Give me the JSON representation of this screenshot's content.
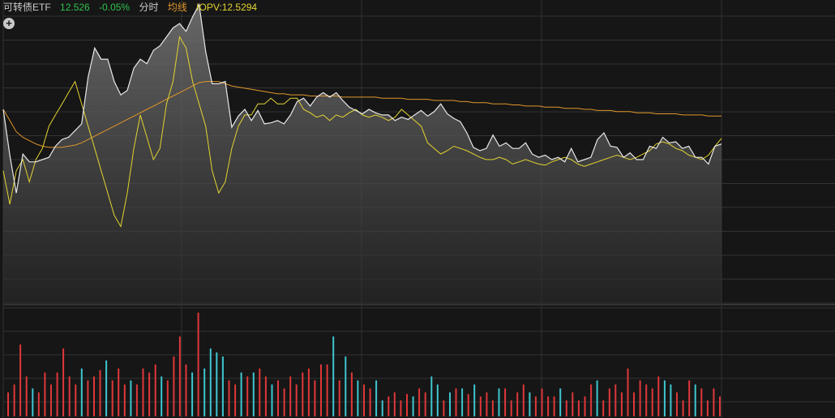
{
  "header": {
    "name": "可转债ETF",
    "price": "12.526",
    "change": "-0.05%",
    "time_label": "分时",
    "ma_label": "均线",
    "iopv_label": "IOPV:12.5294"
  },
  "colors": {
    "background": "#161616",
    "name": "#cccccc",
    "down": "#2fc24f",
    "price_line": "#e8e8e8",
    "ma_line": "#e0962c",
    "iopv_line": "#e3d431",
    "vol_up": "#e0373a",
    "vol_down": "#3ec6d0",
    "grid": "#333333"
  },
  "icons": {
    "zoom": "plus-circle-icon"
  },
  "chart_data": {
    "type": "line",
    "price_range": [
      12.38,
      12.64
    ],
    "price_series": [
      12.555,
      12.514,
      12.48,
      12.515,
      12.508,
      12.508,
      12.51,
      12.512,
      12.522,
      12.528,
      12.53,
      12.536,
      12.542,
      12.584,
      12.61,
      12.6,
      12.6,
      12.58,
      12.568,
      12.572,
      12.592,
      12.6,
      12.596,
      12.608,
      12.612,
      12.62,
      12.628,
      12.632,
      12.625,
      12.638,
      12.649,
      12.607,
      12.578,
      12.578,
      12.58,
      12.539,
      12.549,
      12.555,
      12.545,
      12.554,
      12.542,
      12.543,
      12.545,
      12.542,
      12.55,
      12.562,
      12.565,
      12.558,
      12.566,
      12.57,
      12.566,
      12.57,
      12.563,
      12.557,
      12.554,
      12.551,
      12.555,
      12.552,
      12.55,
      12.55,
      12.545,
      12.548,
      12.546,
      12.55,
      12.554,
      12.549,
      12.553,
      12.56,
      12.551,
      12.547,
      12.544,
      12.534,
      12.521,
      12.518,
      12.52,
      12.532,
      12.522,
      12.525,
      12.52,
      12.52,
      12.525,
      12.515,
      12.512,
      12.514,
      12.51,
      12.512,
      12.508,
      12.52,
      12.508,
      12.51,
      12.512,
      12.528,
      12.534,
      12.522,
      12.521,
      12.512,
      12.516,
      12.51,
      12.51,
      12.522,
      12.52,
      12.53,
      12.525,
      12.526,
      12.52,
      12.522,
      12.512,
      12.512,
      12.506,
      12.522,
      12.524
    ],
    "iopv_series": [
      12.5,
      12.47,
      12.5,
      12.51,
      12.49,
      12.51,
      12.52,
      12.54,
      12.55,
      12.56,
      12.57,
      12.58,
      12.56,
      12.54,
      12.52,
      12.5,
      12.48,
      12.46,
      12.45,
      12.48,
      12.52,
      12.55,
      12.53,
      12.51,
      12.52,
      12.56,
      12.58,
      12.62,
      12.61,
      12.58,
      12.56,
      12.54,
      12.5,
      12.48,
      12.49,
      12.52,
      12.54,
      12.55,
      12.55,
      12.56,
      12.56,
      12.565,
      12.56,
      12.56,
      12.565,
      12.565,
      12.555,
      12.552,
      12.548,
      12.55,
      12.545,
      12.55,
      12.548,
      12.552,
      12.555,
      12.55,
      12.548,
      12.55,
      12.548,
      12.545,
      12.548,
      12.555,
      12.55,
      12.545,
      12.54,
      12.525,
      12.52,
      12.515,
      12.518,
      12.522,
      12.52,
      12.518,
      12.515,
      12.512,
      12.51,
      12.51,
      12.512,
      12.51,
      12.506,
      12.508,
      12.51,
      12.508,
      12.506,
      12.505,
      12.508,
      12.51,
      12.512,
      12.51,
      12.506,
      12.504,
      12.506,
      12.508,
      12.51,
      12.512,
      12.514,
      12.512,
      12.51,
      12.512,
      12.515,
      12.518,
      12.524,
      12.526,
      12.524,
      12.52,
      12.518,
      12.514,
      12.512,
      12.51,
      12.514,
      12.522,
      12.529
    ],
    "ma_series": [
      12.555,
      12.545,
      12.535,
      12.53,
      12.527,
      12.524,
      12.522,
      12.521,
      12.521,
      12.521,
      12.522,
      12.523,
      12.525,
      12.528,
      12.531,
      12.534,
      12.537,
      12.54,
      12.543,
      12.546,
      12.549,
      12.552,
      12.555,
      12.558,
      12.561,
      12.564,
      12.567,
      12.57,
      12.573,
      12.576,
      12.579,
      12.58,
      12.58,
      12.58,
      12.578,
      12.576,
      12.575,
      12.574,
      12.573,
      12.572,
      12.571,
      12.57,
      12.569,
      12.569,
      12.568,
      12.568,
      12.568,
      12.567,
      12.567,
      12.567,
      12.567,
      12.567,
      12.566,
      12.566,
      12.566,
      12.566,
      12.566,
      12.566,
      12.565,
      12.565,
      12.565,
      12.565,
      12.564,
      12.564,
      12.564,
      12.564,
      12.563,
      12.563,
      12.563,
      12.563,
      12.562,
      12.562,
      12.561,
      12.561,
      12.561,
      12.56,
      12.56,
      12.56,
      12.559,
      12.559,
      12.558,
      12.558,
      12.558,
      12.557,
      12.557,
      12.557,
      12.556,
      12.556,
      12.556,
      12.555,
      12.555,
      12.554,
      12.554,
      12.554,
      12.553,
      12.553,
      12.553,
      12.552,
      12.552,
      12.552,
      12.551,
      12.551,
      12.551,
      12.551,
      12.55,
      12.55,
      12.55,
      12.55,
      12.549,
      12.549,
      12.549
    ],
    "volumes": [
      [
        30,
        "r"
      ],
      [
        40,
        "r"
      ],
      [
        90,
        "r"
      ],
      [
        50,
        "r"
      ],
      [
        35,
        "c"
      ],
      [
        30,
        "r"
      ],
      [
        55,
        "r"
      ],
      [
        40,
        "r"
      ],
      [
        55,
        "r"
      ],
      [
        85,
        "r"
      ],
      [
        50,
        "r"
      ],
      [
        40,
        "r"
      ],
      [
        60,
        "c"
      ],
      [
        45,
        "r"
      ],
      [
        50,
        "r"
      ],
      [
        58,
        "r"
      ],
      [
        70,
        "c"
      ],
      [
        45,
        "r"
      ],
      [
        60,
        "r"
      ],
      [
        40,
        "r"
      ],
      [
        45,
        "c"
      ],
      [
        40,
        "r"
      ],
      [
        60,
        "r"
      ],
      [
        55,
        "r"
      ],
      [
        65,
        "r"
      ],
      [
        50,
        "c"
      ],
      [
        45,
        "r"
      ],
      [
        75,
        "r"
      ],
      [
        100,
        "r"
      ],
      [
        65,
        "r"
      ],
      [
        55,
        "c"
      ],
      [
        130,
        "r"
      ],
      [
        60,
        "c"
      ],
      [
        85,
        "c"
      ],
      [
        80,
        "c"
      ],
      [
        75,
        "c"
      ],
      [
        45,
        "r"
      ],
      [
        40,
        "r"
      ],
      [
        55,
        "c"
      ],
      [
        50,
        "r"
      ],
      [
        55,
        "c"
      ],
      [
        60,
        "r"
      ],
      [
        50,
        "r"
      ],
      [
        40,
        "c"
      ],
      [
        45,
        "r"
      ],
      [
        35,
        "r"
      ],
      [
        50,
        "r"
      ],
      [
        40,
        "r"
      ],
      [
        55,
        "r"
      ],
      [
        60,
        "r"
      ],
      [
        45,
        "r"
      ],
      [
        65,
        "r"
      ],
      [
        65,
        "r"
      ],
      [
        100,
        "c"
      ],
      [
        45,
        "r"
      ],
      [
        75,
        "c"
      ],
      [
        55,
        "r"
      ],
      [
        45,
        "c"
      ],
      [
        40,
        "r"
      ],
      [
        35,
        "r"
      ],
      [
        45,
        "c"
      ],
      [
        20,
        "c"
      ],
      [
        25,
        "r"
      ],
      [
        30,
        "r"
      ],
      [
        20,
        "r"
      ],
      [
        28,
        "r"
      ],
      [
        25,
        "c"
      ],
      [
        35,
        "r"
      ],
      [
        30,
        "r"
      ],
      [
        50,
        "c"
      ],
      [
        40,
        "c"
      ],
      [
        20,
        "r"
      ],
      [
        30,
        "c"
      ],
      [
        35,
        "r"
      ],
      [
        35,
        "c"
      ],
      [
        28,
        "r"
      ],
      [
        40,
        "c"
      ],
      [
        25,
        "r"
      ],
      [
        30,
        "r"
      ],
      [
        20,
        "r"
      ],
      [
        35,
        "c"
      ],
      [
        35,
        "r"
      ],
      [
        20,
        "r"
      ],
      [
        30,
        "r"
      ],
      [
        40,
        "r"
      ],
      [
        30,
        "c"
      ],
      [
        25,
        "r"
      ],
      [
        35,
        "r"
      ],
      [
        25,
        "r"
      ],
      [
        25,
        "r"
      ],
      [
        35,
        "c"
      ],
      [
        20,
        "r"
      ],
      [
        30,
        "r"
      ],
      [
        20,
        "r"
      ],
      [
        25,
        "r"
      ],
      [
        40,
        "r"
      ],
      [
        45,
        "c"
      ],
      [
        20,
        "r"
      ],
      [
        35,
        "r"
      ],
      [
        40,
        "r"
      ],
      [
        30,
        "r"
      ],
      [
        60,
        "r"
      ],
      [
        30,
        "r"
      ],
      [
        45,
        "r"
      ],
      [
        40,
        "r"
      ],
      [
        35,
        "r"
      ],
      [
        50,
        "r"
      ],
      [
        45,
        "c"
      ],
      [
        40,
        "c"
      ],
      [
        30,
        "r"
      ],
      [
        20,
        "r"
      ],
      [
        45,
        "r"
      ],
      [
        40,
        "c"
      ],
      [
        35,
        "r"
      ],
      [
        20,
        "r"
      ],
      [
        35,
        "r"
      ],
      [
        25,
        "r"
      ]
    ]
  }
}
